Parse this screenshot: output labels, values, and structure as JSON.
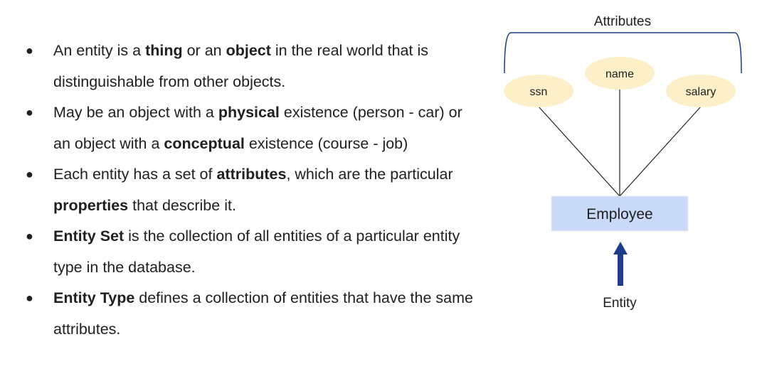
{
  "bullets": [
    {
      "segments": [
        {
          "text": "An entity is a ",
          "bold": false
        },
        {
          "text": "thing",
          "bold": true
        },
        {
          "text": " or an ",
          "bold": false
        },
        {
          "text": "object",
          "bold": true
        },
        {
          "text": " in the real world that is distinguishable from other objects.",
          "bold": false
        }
      ]
    },
    {
      "segments": [
        {
          "text": "May be an object with a ",
          "bold": false
        },
        {
          "text": "physical",
          "bold": true
        },
        {
          "text": " existence (person - car) or an object with a ",
          "bold": false
        },
        {
          "text": "conceptual",
          "bold": true
        },
        {
          "text": " existence (course - job)",
          "bold": false
        }
      ]
    },
    {
      "segments": [
        {
          "text": "Each entity has a set of ",
          "bold": false
        },
        {
          "text": "attributes",
          "bold": true
        },
        {
          "text": ", which are the particular ",
          "bold": false
        },
        {
          "text": "properties",
          "bold": true
        },
        {
          "text": " that describe it.",
          "bold": false
        }
      ]
    },
    {
      "segments": [
        {
          "text": "Entity Set",
          "bold": true
        },
        {
          "text": " is the collection of all entities of a particular entity type in the database.",
          "bold": false
        }
      ]
    },
    {
      "segments": [
        {
          "text": "Entity Type",
          "bold": true
        },
        {
          "text": " defines a collection of entities that have the same attributes.",
          "bold": false
        }
      ]
    }
  ],
  "diagram": {
    "attributes_label": "Attributes",
    "attributes": [
      "ssn",
      "name",
      "salary"
    ],
    "entity_name": "Employee",
    "entity_label": "Entity",
    "colors": {
      "attribute_fill": "#fdf0c8",
      "entity_fill": "#c9daf8",
      "arrow": "#1f3c88",
      "brace": "#1f3c88"
    }
  }
}
